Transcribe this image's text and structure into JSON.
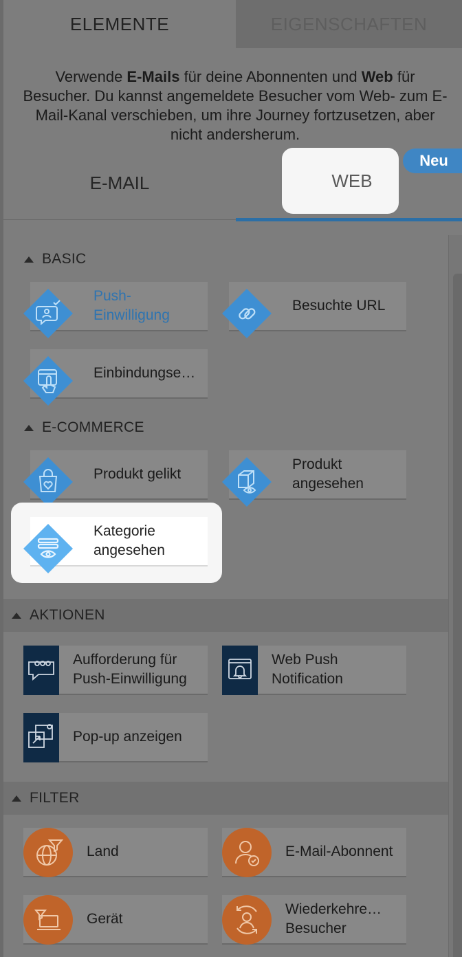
{
  "top_tabs": {
    "elements": "ELEMENTE",
    "properties": "EIGENSCHAFTEN"
  },
  "intro": {
    "part1": "Verwende ",
    "email_bold": "E-Mails",
    "part2": " für deine Abonnenten und ",
    "web_bold": "Web",
    "part3": " für Besucher. Du kannst angemeldete Besucher vom Web- zum E-Mail-Kanal verschieben, um ihre Journey fortzusetzen, aber nicht andersherum."
  },
  "channel_tabs": {
    "email": "E-MAIL",
    "web": "WEB",
    "new_badge": "Neu"
  },
  "sections": {
    "basic": {
      "title": "BASIC",
      "items": [
        {
          "label": "Push-Einwilligung",
          "icon": "push-consent-icon"
        },
        {
          "label": "Besuchte URL",
          "icon": "link-icon"
        },
        {
          "label": "Einbindungse…",
          "icon": "touch-icon"
        }
      ]
    },
    "ecommerce": {
      "title": "E-COMMERCE",
      "items": [
        {
          "label": "Produkt gelikt",
          "icon": "bag-heart-icon"
        },
        {
          "label": "Produkt angesehen",
          "icon": "box-eye-icon"
        },
        {
          "label": "Kategorie angesehen",
          "icon": "list-eye-icon"
        }
      ]
    },
    "actions": {
      "title": "AKTIONEN",
      "items": [
        {
          "label": "Aufforderung für Push-Einwilligung",
          "icon": "chat-bubble-icon"
        },
        {
          "label": "Web Push Notification",
          "icon": "bell-window-icon"
        },
        {
          "label": "Pop-up anzeigen",
          "icon": "popup-icon"
        }
      ]
    },
    "filter": {
      "title": "FILTER",
      "items": [
        {
          "label": "Land",
          "icon": "globe-filter-icon"
        },
        {
          "label": "E-Mail-Abonnent",
          "icon": "user-check-icon"
        },
        {
          "label": "Gerät",
          "icon": "device-icon"
        },
        {
          "label": "Wiederkehre… Besucher",
          "icon": "returning-user-icon"
        }
      ]
    }
  },
  "colors": {
    "diamond_blue": "#3e8fd3",
    "diamond_light_blue": "#5eb2f0",
    "action_navy": "#0f2a45",
    "filter_orange": "#c0642a",
    "accent_blue": "#2f74b0"
  }
}
